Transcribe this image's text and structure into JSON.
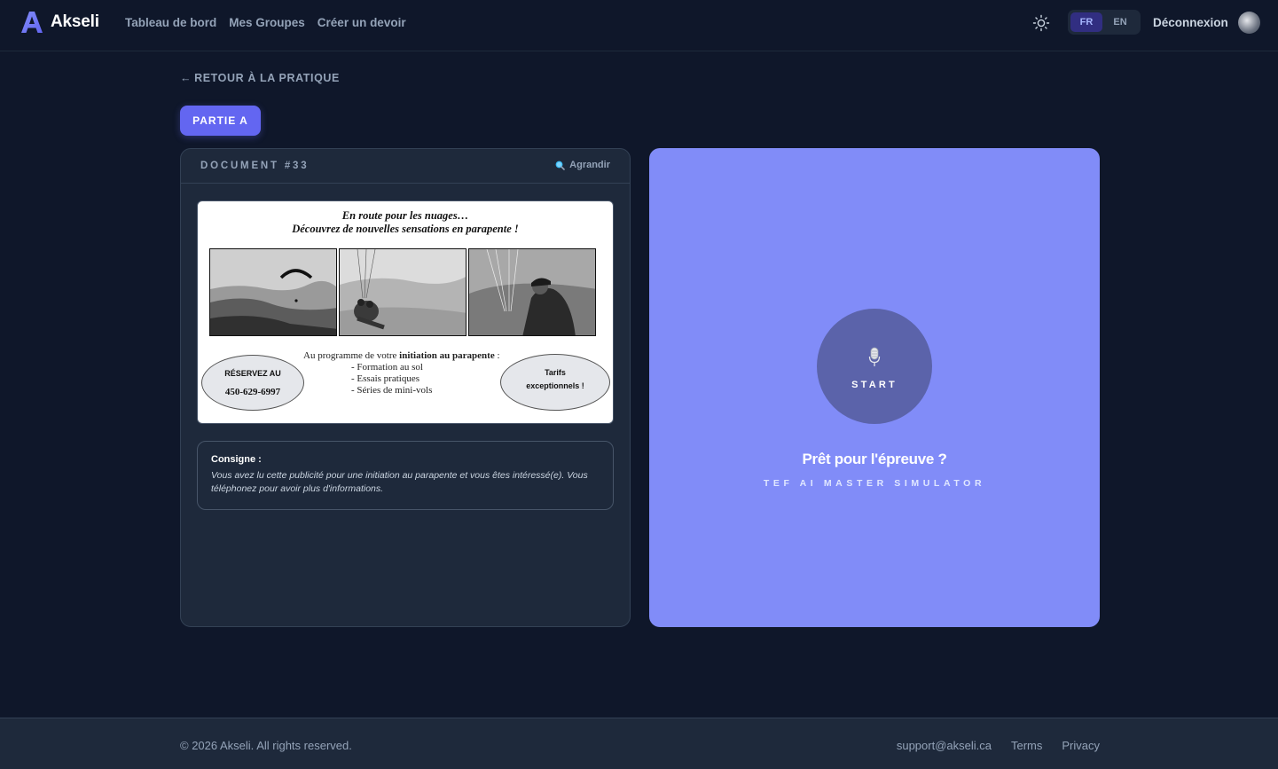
{
  "header": {
    "brand": "Akseli",
    "nav": [
      "Tableau de bord",
      "Mes Groupes",
      "Créer un devoir"
    ],
    "lang_options": [
      "FR",
      "EN"
    ],
    "lang_active": "FR",
    "logout_label": "Déconnexion"
  },
  "back_link": "RETOUR À LA PRATIQUE",
  "part_button": "PARTIE A",
  "document": {
    "title": "DOCUMENT #33",
    "enlarge_label": "Agrandir",
    "ad": {
      "headline1": "En route pour les nuages…",
      "headline2": "Découvrez de nouvelles sensations en parapente !",
      "program_intro": "Au programme de votre ",
      "program_bold": "initiation au parapente",
      "program_end": " :",
      "items": [
        "- Formation au sol",
        "- Essais pratiques",
        "- Séries de mini-vols"
      ],
      "reserve_label": "RÉSERVEZ AU",
      "phone": "450-629-6997",
      "rates_line1": "Tarifs",
      "rates_line2": "exceptionnels !"
    },
    "consigne_label": "Consigne :",
    "consigne_text": "Vous avez lu cette publicité pour une initiation au parapente et vous êtes intéressé(e). Vous téléphonez pour avoir plus d'informations."
  },
  "simulator": {
    "start_label": "START",
    "title": "Prêt pour l'épreuve ?",
    "subtitle": "TEF AI MASTER SIMULATOR"
  },
  "footer": {
    "copyright": "© 2026 Akseli. All rights reserved.",
    "links": [
      "support@akseli.ca",
      "Terms",
      "Privacy"
    ]
  },
  "colors": {
    "background": "#0f172a",
    "accent": "#6366f1",
    "simulator_panel": "#818cf8"
  }
}
